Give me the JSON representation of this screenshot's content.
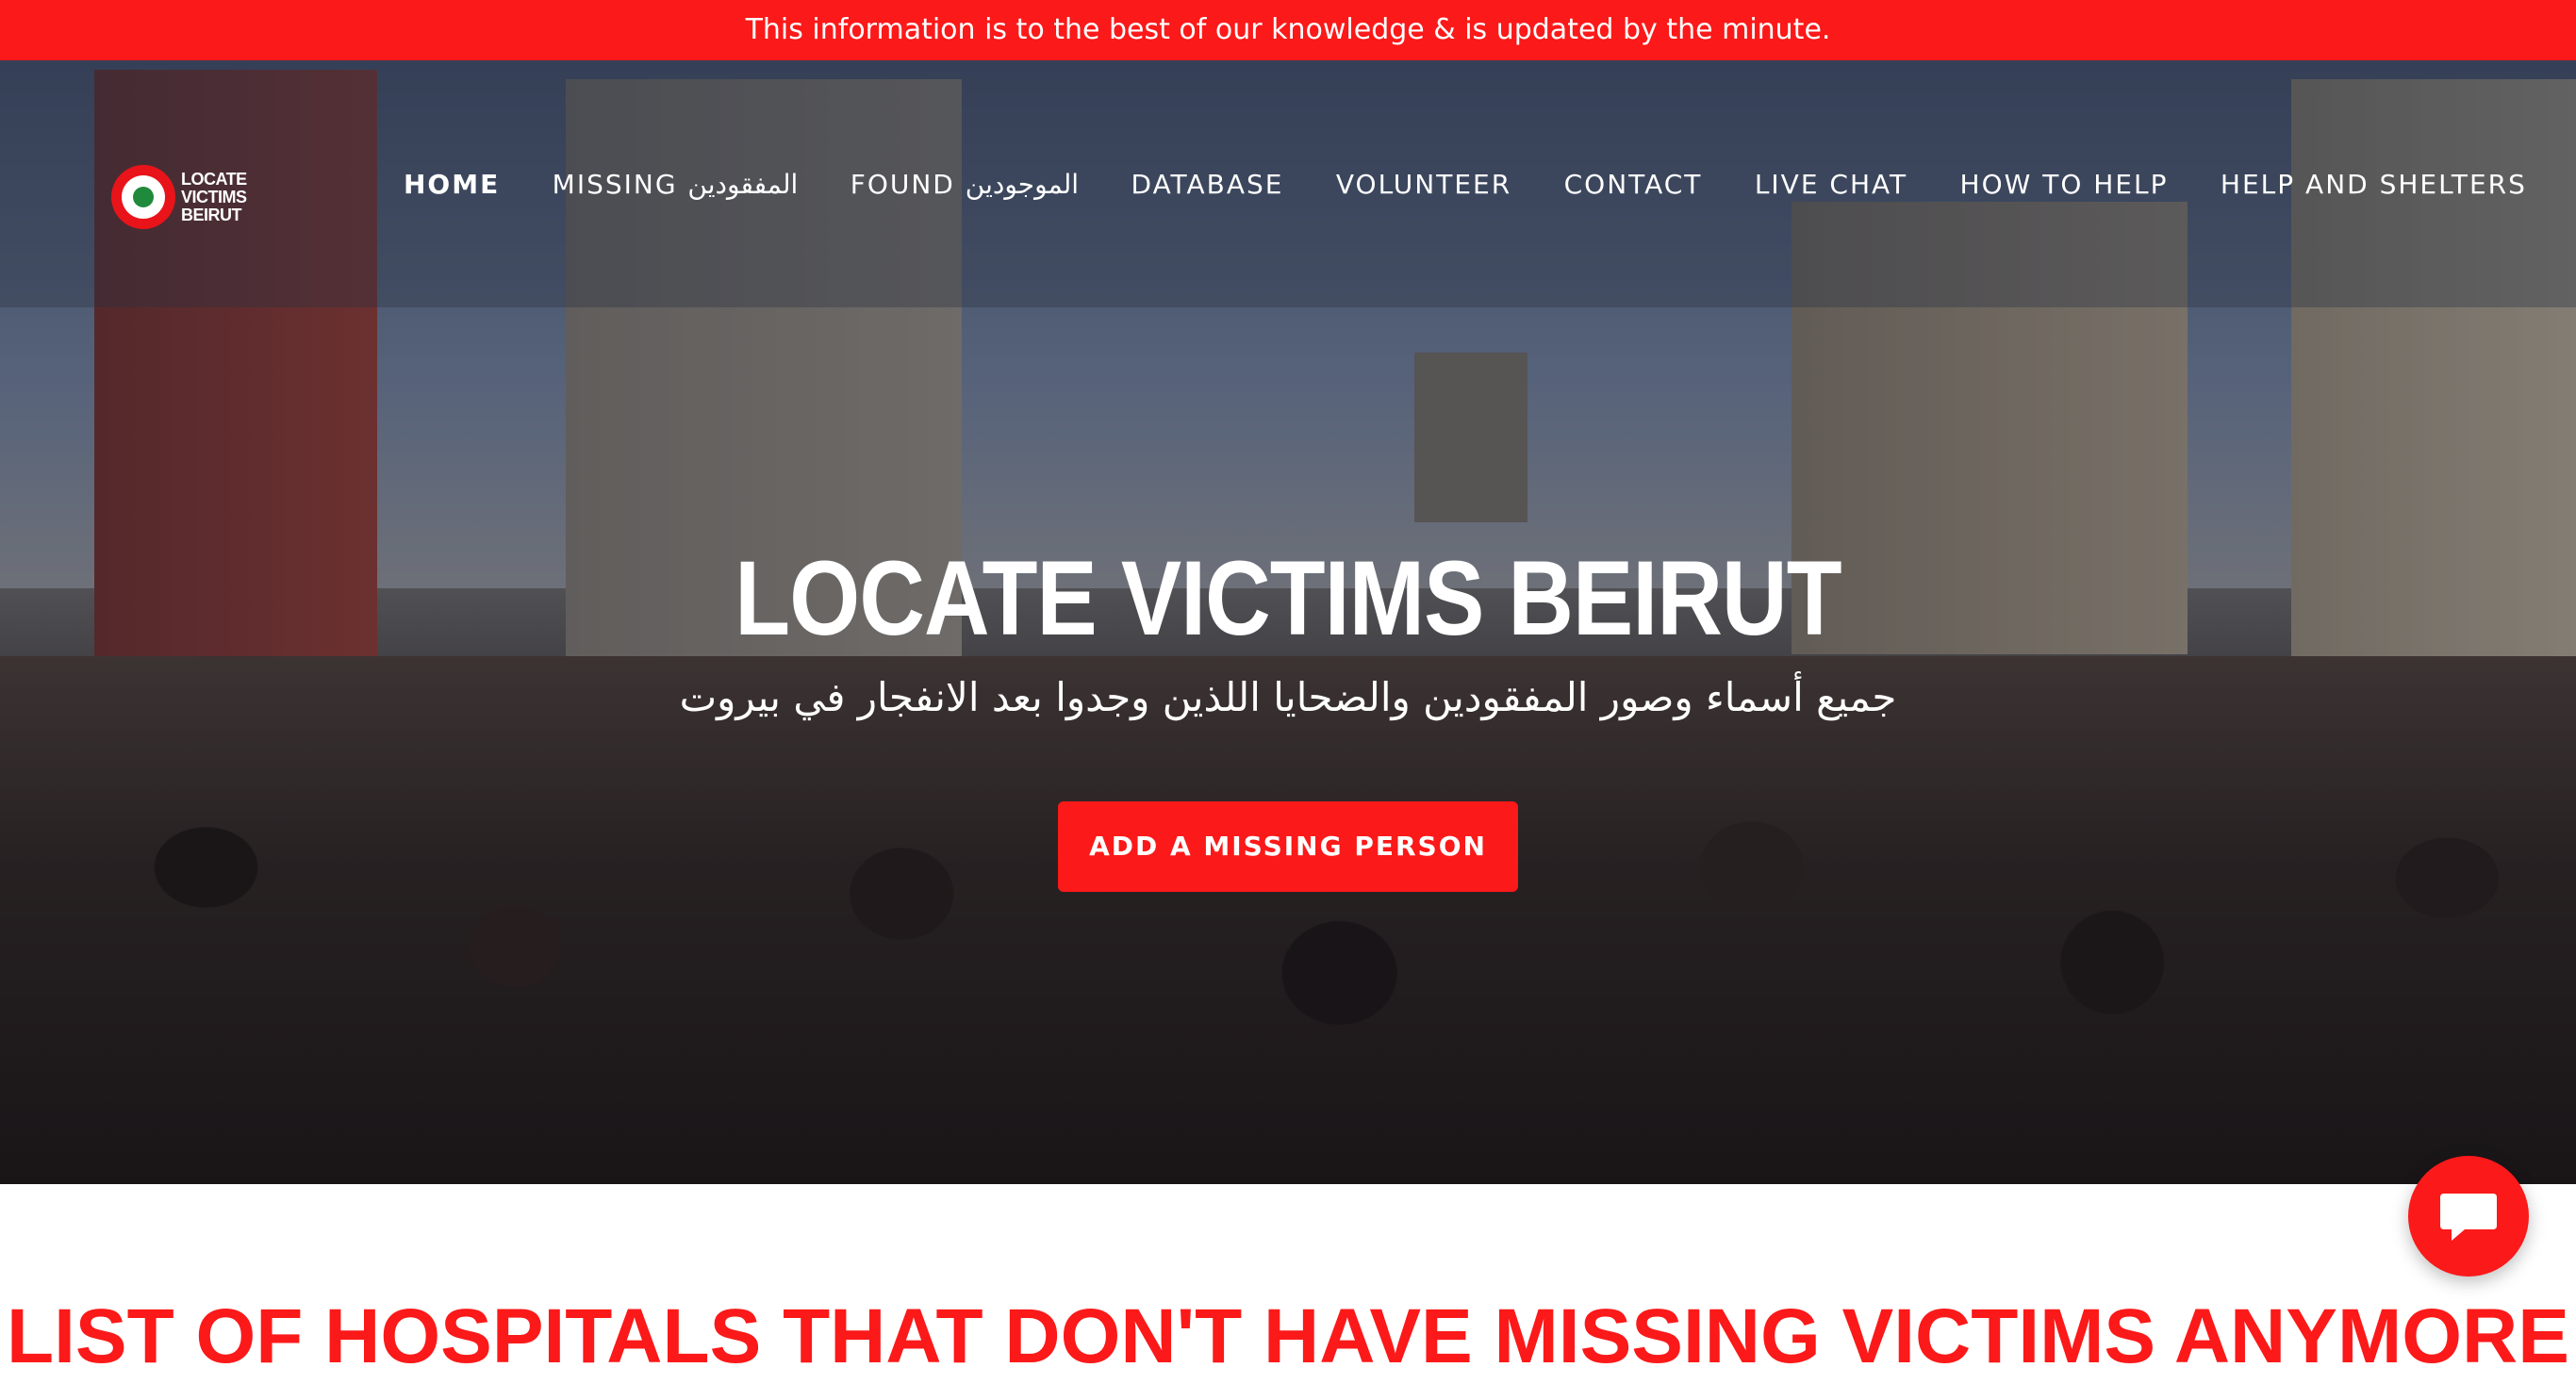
{
  "announcement": {
    "text": "This information is to the best of our knowledge & is updated by the minute."
  },
  "logo": {
    "line1": "LOCATE",
    "line2": "VICTIMS",
    "line3": "BEIRUT"
  },
  "nav": {
    "items": [
      {
        "label": "HOME",
        "active": true
      },
      {
        "label": "MISSING المفقودين",
        "active": false
      },
      {
        "label": "FOUND الموجودين",
        "active": false
      },
      {
        "label": "DATABASE",
        "active": false
      },
      {
        "label": "VOLUNTEER",
        "active": false
      },
      {
        "label": "CONTACT",
        "active": false
      },
      {
        "label": "LIVE CHAT",
        "active": false
      },
      {
        "label": "HOW TO HELP",
        "active": false
      },
      {
        "label": "HELP AND SHELTERS",
        "active": false
      }
    ]
  },
  "hero": {
    "title": "LOCATE VICTIMS BEIRUT",
    "subtitle": "جميع أسماء وصور المفقودين والضحايا اللذين وجدوا بعد الانفجار في بيروت",
    "cta_label": "ADD A MISSING PERSON"
  },
  "section": {
    "heading": "LIST OF HOSPITALS THAT DON'T HAVE MISSING VICTIMS ANYMORE"
  },
  "colors": {
    "accent": "#fb1919",
    "text_on_accent": "#ffffff"
  },
  "icons": {
    "chat": "chat-bubble-icon",
    "logo": "target-ring-icon"
  }
}
